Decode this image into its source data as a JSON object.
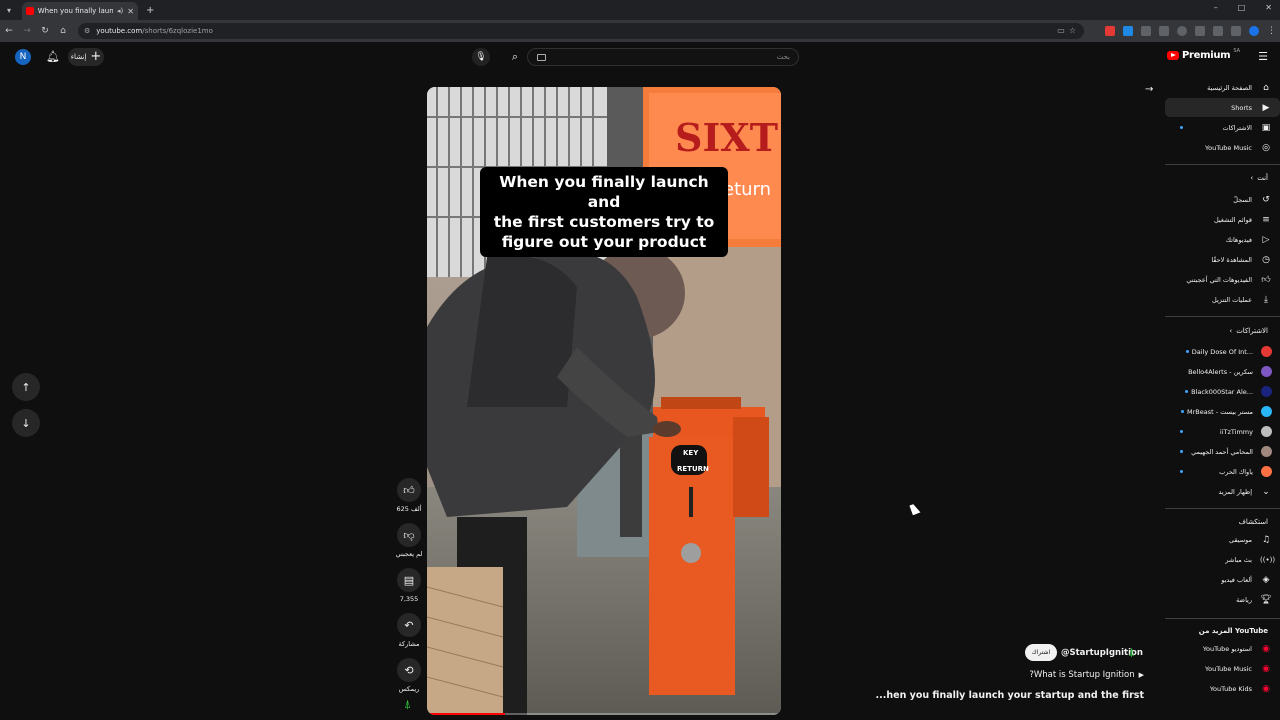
{
  "browser": {
    "tab_title": "When you finally launch yo",
    "url_host": "youtube.com",
    "url_path": "/shorts/6zqlozie1mo",
    "window_controls": [
      "–",
      "□",
      "✕"
    ]
  },
  "header": {
    "avatar_letter": "N",
    "create_label": "إنشاء",
    "search_placeholder": "بحث",
    "logo_text": "Premium",
    "logo_region": "SA"
  },
  "video": {
    "caption_line1": "When you finally launch and",
    "caption_line2": "the first customers try to",
    "caption_line3": "figure out your product",
    "sign_text": "SIXT",
    "sign_sub": "eturn",
    "box_label1": "KEY",
    "box_label2": "RETURN",
    "progress_fraction": 0.22
  },
  "actions": {
    "like_count": "625 ألف",
    "dislike_label": "لم يعجبني",
    "comment_count": "7,355",
    "share_label": "مشاركة",
    "remix_label": "ريمكس"
  },
  "channel": {
    "subscribe_label": "اشتراك",
    "handle": "@StartupIgnition",
    "link_text": "?What is Startup Ignition",
    "title": "...hen you finally launch your startup and the first"
  },
  "sidebar": {
    "main": [
      {
        "label": "الصفحة الرئيسية",
        "icon": "⌂",
        "name": "home"
      },
      {
        "label": "Shorts",
        "icon": "▶",
        "name": "shorts"
      },
      {
        "label": "الاشتراكات",
        "icon": "▣",
        "name": "subscriptions"
      },
      {
        "label": "YouTube Music",
        "icon": "◎",
        "name": "youtube-music"
      }
    ],
    "you_header": "أنت",
    "you": [
      {
        "label": "السجلّ",
        "icon": "↺",
        "name": "history"
      },
      {
        "label": "قوائم التشغيل",
        "icon": "≡",
        "name": "playlists"
      },
      {
        "label": "فيديوهاتك",
        "icon": "▷",
        "name": "your-videos"
      },
      {
        "label": "المشاهدة لاحقًا",
        "icon": "◷",
        "name": "watch-later"
      },
      {
        "label": "الفيديوهات التي أعجبتني",
        "icon": "👍",
        "name": "liked-videos"
      },
      {
        "label": "عمليات التنزيل",
        "icon": "⤓",
        "name": "downloads"
      }
    ],
    "subs_header": "الاشتراكات",
    "subs": [
      {
        "label": "Daily Dose Of Int...",
        "color": "#e53935"
      },
      {
        "label": "Bello4Alerts - سكرين",
        "color": "#7e57c2"
      },
      {
        "label": "Black000Star Ale...",
        "color": "#1a237e"
      },
      {
        "label": "MrBeast - مستر بيست",
        "color": "#29b6f6"
      },
      {
        "label": "iiTzTimmy",
        "color": "#bdbdbd"
      },
      {
        "label": "المحامي أحمد الجهيمي",
        "color": "#a1887f"
      },
      {
        "label": "ياواك الحرب",
        "color": "#ff7043"
      }
    ],
    "show_more": "إظهار المزيد",
    "explore_header": "استكشاف",
    "explore": [
      {
        "label": "موسيقى",
        "icon": "♫",
        "name": "music"
      },
      {
        "label": "بث مباشر",
        "icon": "((•))",
        "name": "live"
      },
      {
        "label": "ألعاب فيديو",
        "icon": "◈",
        "name": "gaming"
      },
      {
        "label": "رياضة",
        "icon": "🏆",
        "name": "sports"
      }
    ],
    "more_header": "المزيد من YouTube",
    "more": [
      {
        "label": "YouTube استوديو",
        "name": "studio"
      },
      {
        "label": "YouTube Music",
        "name": "music-app"
      },
      {
        "label": "YouTube Kids",
        "name": "kids"
      }
    ]
  }
}
